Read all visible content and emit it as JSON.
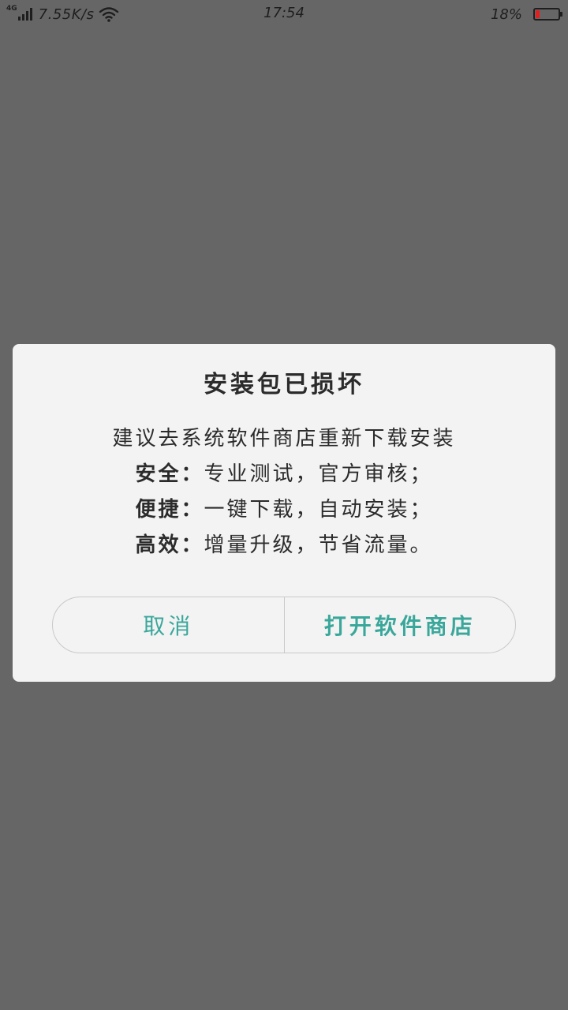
{
  "status_bar": {
    "network_type": "4G",
    "net_speed": "7.55K/s",
    "time": "17:54",
    "battery_percent": "18%",
    "battery_level": 0.18,
    "battery_color": "#e02020",
    "icons": [
      "signal-icon",
      "wifi-icon",
      "battery-icon"
    ]
  },
  "dialog": {
    "title": "安装包已损坏",
    "message": "建议去系统软件商店重新下载安装",
    "features": [
      {
        "label": "安全：",
        "text": "专业测试，官方审核；"
      },
      {
        "label": "便捷：",
        "text": "一键下载，自动安装；"
      },
      {
        "label": "高效：",
        "text": "增量升级，节省流量。"
      }
    ],
    "cancel_label": "取消",
    "confirm_label": "打开软件商店"
  },
  "colors": {
    "overlay": "#666666",
    "dialog_bg": "#f3f3f3",
    "accent": "#3aa79b"
  }
}
